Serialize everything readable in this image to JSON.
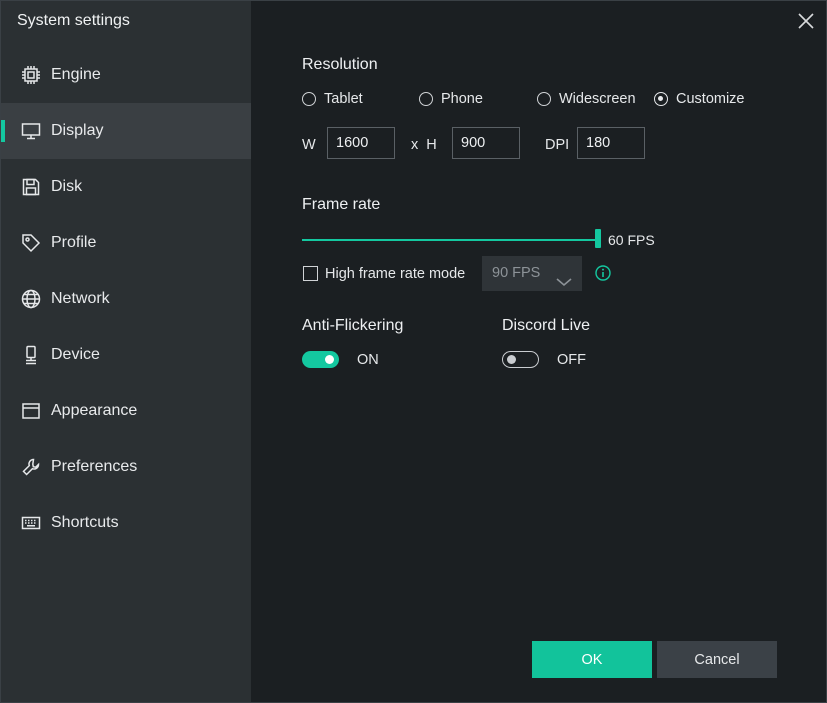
{
  "window": {
    "title": "System settings"
  },
  "sidebar": {
    "items": [
      {
        "label": "Engine",
        "icon": "cpu-chip-icon"
      },
      {
        "label": "Display",
        "icon": "monitor-icon",
        "active": true
      },
      {
        "label": "Disk",
        "icon": "floppy-disk-icon"
      },
      {
        "label": "Profile",
        "icon": "tag-icon"
      },
      {
        "label": "Network",
        "icon": "globe-icon"
      },
      {
        "label": "Device",
        "icon": "device-icon"
      },
      {
        "label": "Appearance",
        "icon": "window-icon"
      },
      {
        "label": "Preferences",
        "icon": "wrench-icon"
      },
      {
        "label": "Shortcuts",
        "icon": "keyboard-icon"
      }
    ]
  },
  "resolution": {
    "title": "Resolution",
    "options": [
      {
        "label": "Tablet",
        "checked": false
      },
      {
        "label": "Phone",
        "checked": false
      },
      {
        "label": "Widescreen",
        "checked": false
      },
      {
        "label": "Customize",
        "checked": true
      }
    ],
    "width_label": "W",
    "width_value": "1600",
    "height_label": "x  H",
    "height_value": "900",
    "dpi_label": "DPI",
    "dpi_value": "180"
  },
  "frame_rate": {
    "title": "Frame rate",
    "value_label": "60 FPS",
    "slider_fraction": 1.0,
    "high_mode_label": "High frame rate mode",
    "high_mode_checked": false,
    "high_mode_select": "90 FPS"
  },
  "anti_flickering": {
    "title": "Anti-Flickering",
    "state": "ON",
    "on": true
  },
  "discord_live": {
    "title": "Discord Live",
    "state": "OFF",
    "on": false
  },
  "buttons": {
    "ok": "OK",
    "cancel": "Cancel"
  },
  "colors": {
    "accent": "#14c8a0",
    "sidebar": "#2b3033",
    "background": "#1b1f22"
  }
}
